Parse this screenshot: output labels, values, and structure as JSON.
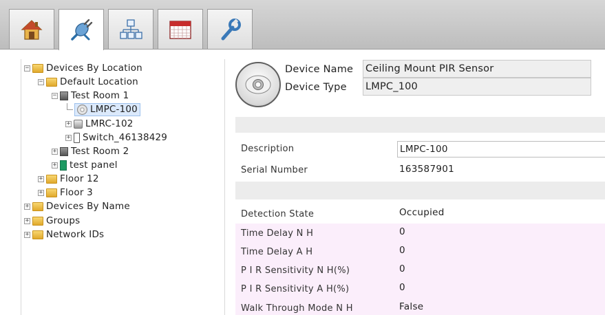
{
  "toolbar": {
    "tabs": [
      {
        "icon": "home-icon"
      },
      {
        "icon": "plug-icon",
        "active": true
      },
      {
        "icon": "hierarchy-icon"
      },
      {
        "icon": "calendar-icon"
      },
      {
        "icon": "wrench-icon"
      }
    ]
  },
  "tree": {
    "devices_by_location": "Devices By Location",
    "default_location": "Default Location",
    "test_room_1": "Test Room 1",
    "lmpc_100": "LMPC-100",
    "lmrc_102": "LMRC-102",
    "switch": "Switch_46138429",
    "test_room_2": "Test Room 2",
    "test_panel": "test panel",
    "floor_12": "Floor 12",
    "floor_3": "Floor 3",
    "devices_by_name": "Devices By Name",
    "groups": "Groups",
    "network_ids": "Network IDs"
  },
  "device": {
    "name_label": "Device Name",
    "name_value": "Ceiling Mount PIR Sensor",
    "type_label": "Device Type",
    "type_value": "LMPC_100",
    "icon": "sensor-icon"
  },
  "properties": {
    "description_label": "Description",
    "description_value": "LMPC-100",
    "serial_label": "Serial Number",
    "serial_value": "163587901",
    "detection_label": "Detection State",
    "detection_value": "Occupied",
    "td_nh_label": "Time Delay N H",
    "td_nh_value": "0",
    "td_ah_label": "Time Delay A H",
    "td_ah_value": "0",
    "pir_nh_label": "P I R Sensitivity N H(%)",
    "pir_nh_value": "0",
    "pir_ah_label": "P I R Sensitivity A H(%)",
    "pir_ah_value": "0",
    "walk_label": "Walk Through Mode N H",
    "walk_value": "False"
  },
  "colors": {
    "selected_row": "#dbe9fb",
    "pink_row": "#fbeefb",
    "separator": "#ececec"
  }
}
